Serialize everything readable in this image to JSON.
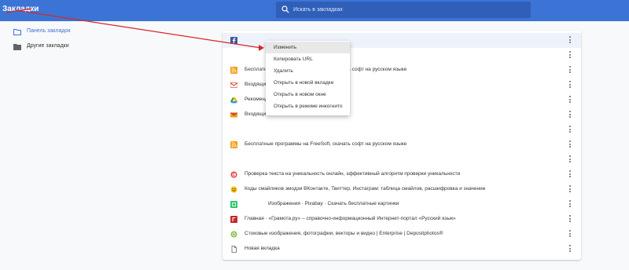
{
  "app": {
    "title": "Закладки"
  },
  "search": {
    "placeholder": "Искать в закладках"
  },
  "sidebar": {
    "items": [
      {
        "label": "Панель закладок",
        "active": true
      },
      {
        "label": "Другие закладки",
        "active": false
      }
    ]
  },
  "bookmarks": [
    {
      "icon": "facebook-icon",
      "text": "",
      "highlight": true
    },
    {
      "icon": "none",
      "text": ""
    },
    {
      "icon": "rss-icon",
      "text": "Бесплатные программы на FreeSoft, скачать софт на русском языке"
    },
    {
      "icon": "gmail-icon",
      "text": "Входящие"
    },
    {
      "icon": "drive-icon",
      "text": "Рекомендуемые"
    },
    {
      "icon": "mail-icon",
      "text": "Входящие"
    },
    {
      "icon": "none",
      "text": ""
    },
    {
      "icon": "rss-icon",
      "text": "Бесплатные программы на FreeSoft, скачать софт на русском языке"
    },
    {
      "icon": "none",
      "text": ""
    },
    {
      "icon": "copyright-icon",
      "text": "Проверка текста на уникальность онлайн, эффективный алгоритм проверки уникальности"
    },
    {
      "icon": "smiley-icon",
      "text": "Коды смайликов эмодзи ВКонтакте, Твиттер, Инстаграм: таблица смайлов, расшифровка и значение"
    },
    {
      "icon": "pixabay-icon",
      "text": "Изображения · Pixabay · Скачать бесплатные картинки"
    },
    {
      "icon": "gramota-icon",
      "text": "Главная · «Грамота.ру» – справочно-информационный Интернет-портал «Русский язык»"
    },
    {
      "icon": "depositphotos-icon",
      "text": "Стоковые изображения, фотографии, векторы и видео | Enterprise | Depositphotos®"
    },
    {
      "icon": "page-icon",
      "text": "Новая вкладка"
    }
  ],
  "context_menu": {
    "items": [
      {
        "label": "Изменить",
        "active": true
      },
      {
        "label": "Копировать URL"
      },
      {
        "label": "Удалить"
      },
      {
        "label": "Открыть в новой вкладке"
      },
      {
        "label": "Открыть в новом окне"
      },
      {
        "label": "Открыть в режиме инкогнито"
      }
    ]
  },
  "colors": {
    "topbar": "#3c74d6",
    "search_bg": "#2f5fb8",
    "active_link": "#3f72d6",
    "annotation_arrow": "#d9252a"
  }
}
